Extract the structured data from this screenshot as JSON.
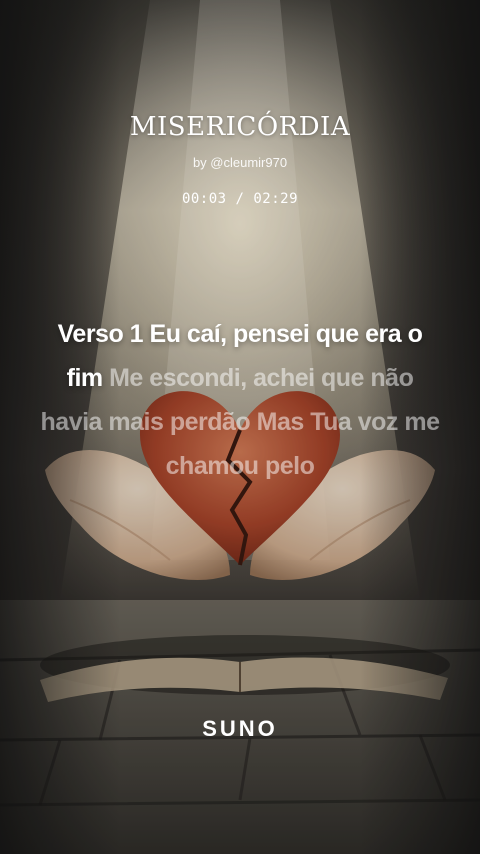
{
  "song": {
    "title": "MISERICÓRDIA",
    "byline": "by @cleumir970",
    "time": "00:03 / 02:29",
    "progress_fraction": 0.0201
  },
  "lyrics": {
    "active": "Verso 1 Eu caí, pensei que era o fim",
    "upcoming": "Me escondi, achei que não havia mais perdão Mas Tua voz me chamou pelo"
  },
  "brand": {
    "logo_text": "SUNO"
  },
  "colors": {
    "text": "#ffffff",
    "background_dark": "#1b1a17",
    "light_beam": "#fff6dc",
    "heart": "#a6442a",
    "hands": "#e9cdb0",
    "book": "#c9b79a"
  }
}
